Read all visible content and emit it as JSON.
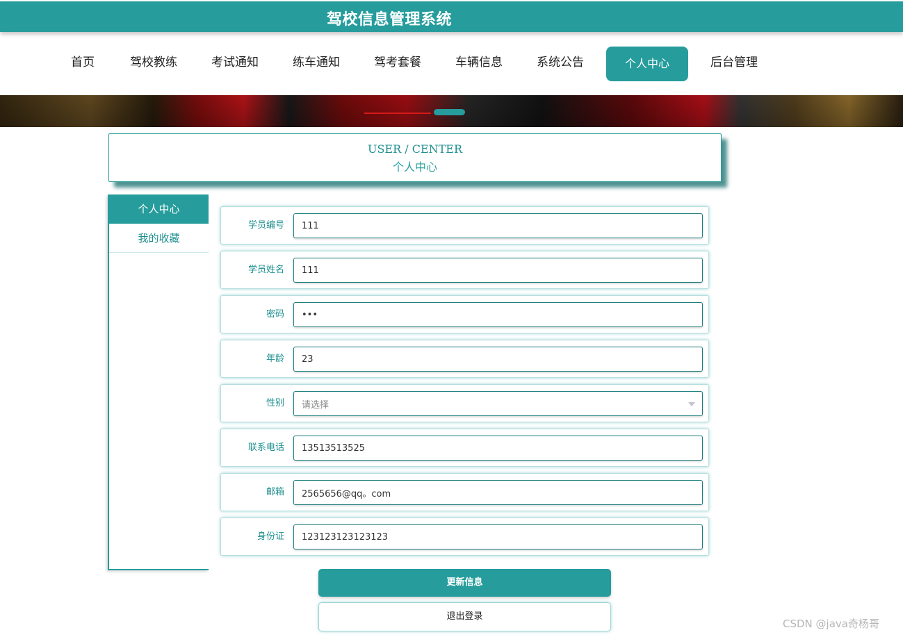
{
  "app": {
    "title": "驾校信息管理系统"
  },
  "nav": {
    "items": [
      {
        "label": "首页",
        "active": false
      },
      {
        "label": "驾校教练",
        "active": false
      },
      {
        "label": "考试通知",
        "active": false
      },
      {
        "label": "练车通知",
        "active": false
      },
      {
        "label": "驾考套餐",
        "active": false
      },
      {
        "label": "车辆信息",
        "active": false
      },
      {
        "label": "系统公告",
        "active": false
      },
      {
        "label": "个人中心",
        "active": true
      },
      {
        "label": "后台管理",
        "active": false
      }
    ]
  },
  "section": {
    "title_en": "USER / CENTER",
    "title_cn": "个人中心"
  },
  "sidebar": {
    "items": [
      {
        "label": "个人中心",
        "active": true
      },
      {
        "label": "我的收藏",
        "active": false
      }
    ]
  },
  "form": {
    "fields": [
      {
        "label": "学员编号",
        "value": "111"
      },
      {
        "label": "学员姓名",
        "value": "111"
      },
      {
        "label": "密码",
        "value": "•••"
      },
      {
        "label": "年龄",
        "value": "23"
      },
      {
        "label": "性别",
        "placeholder": "请选择"
      },
      {
        "label": "联系电话",
        "value": "13513513525"
      },
      {
        "label": "邮箱",
        "value": "2565656@qq。com"
      },
      {
        "label": "身份证",
        "value": "123123123123123"
      }
    ],
    "update_label": "更新信息",
    "logout_label": "退出登录"
  },
  "watermark": "CSDN @java奇杨哥",
  "colors": {
    "accent": "#269c9c",
    "accent_dark": "#1f7f7f",
    "banner_dot": "#269c9c",
    "banner_line": "#d61a1a"
  },
  "icons": {
    "select_caret": "caret-down-icon"
  }
}
